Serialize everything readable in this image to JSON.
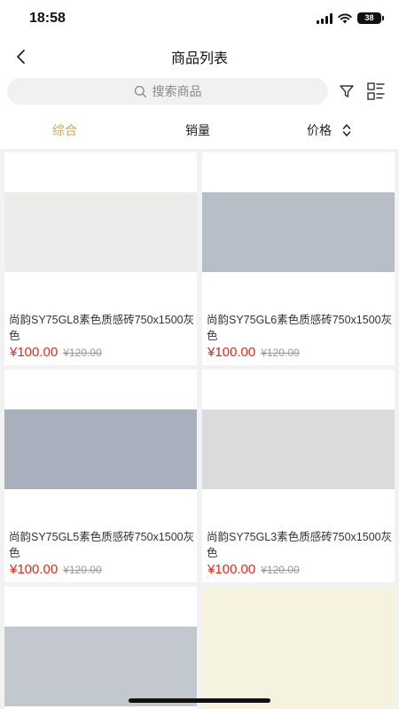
{
  "status_bar": {
    "time": "18:58",
    "battery": "38"
  },
  "nav": {
    "title": "商品列表",
    "back_icon": "chevron-left-icon"
  },
  "search": {
    "placeholder": "搜索商品",
    "icon": "search-icon"
  },
  "toolbar": {
    "filter_icon": "filter-icon",
    "layout_icon": "list-layout-icon"
  },
  "sort_tabs": [
    {
      "label": "综合",
      "active": true
    },
    {
      "label": "销量",
      "active": false
    },
    {
      "label": "价格",
      "active": false,
      "icon": "sort-updown-icon"
    }
  ],
  "colors": {
    "accent": "#d4a05a",
    "price": "#e02a1a"
  },
  "products": [
    {
      "title": "尚韵SY75GL8素色质感砖750x1500灰色",
      "price": "¥100.00",
      "original_price": "¥120.00",
      "swatch_color": "#ececea"
    },
    {
      "title": "尚韵SY75GL6素色质感砖750x1500灰色",
      "price": "¥100.00",
      "original_price": "¥120.00",
      "swatch_color": "#b8bec8"
    },
    {
      "title": "尚韵SY75GL5素色质感砖750x1500灰色",
      "price": "¥100.00",
      "original_price": "¥120.00",
      "swatch_color": "#a7b0bc"
    },
    {
      "title": "尚韵SY75GL3素色质感砖750x1500灰色",
      "price": "¥100.00",
      "original_price": "¥120.00",
      "swatch_color": "#dadbdc"
    },
    {
      "swatch_color": "#c3c8ce"
    },
    {
      "swatch_color": "#f6f2e0"
    }
  ]
}
